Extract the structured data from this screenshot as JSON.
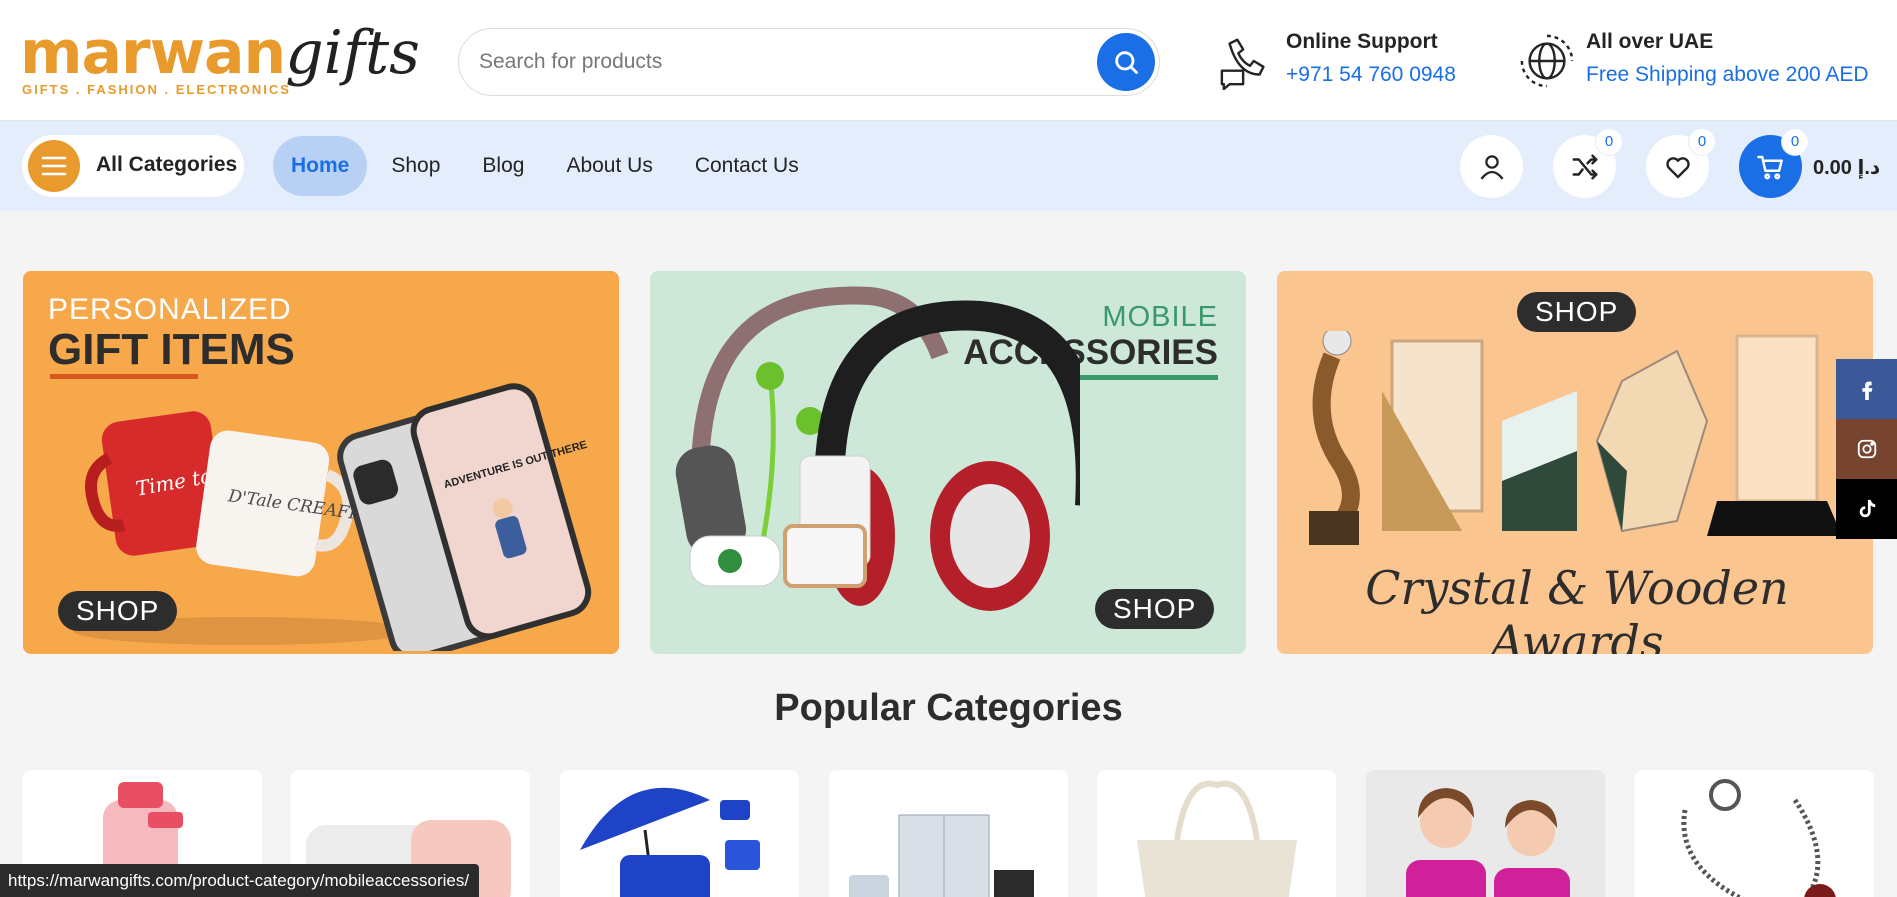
{
  "header": {
    "logo_main": "marwan",
    "logo_script": "gifts",
    "logo_tagline": "GIFTS . FASHION . ELECTRONICS",
    "search_placeholder": "Search for products",
    "support_title": "Online Support",
    "support_phone": "+971 54 760 0948",
    "shipping_title": "All over UAE",
    "shipping_text": "Free Shipping above 200 AED"
  },
  "nav": {
    "all_categories": "All Categories",
    "items": [
      "Home",
      "Shop",
      "Blog",
      "About Us",
      "Contact Us"
    ],
    "active": "Home",
    "compare_count": "0",
    "wishlist_count": "0",
    "cart_count": "0",
    "cart_total": "0.00 د.إ"
  },
  "banners": {
    "b1_small": "PERSONALIZED",
    "b1_big": "GIFT ITEMS",
    "b1_phone_text": "ADVENTURE IS OUT THERE",
    "b1_mug1": "Time to Coffee",
    "b1_mug2": "D'Tale CREAFRIX",
    "b1_shop": "SHOP",
    "b2_small": "MOBILE",
    "b2_big": "ACCESSORIES",
    "b2_shop": "SHOP",
    "b3_shop": "SHOP",
    "b3_script": "Crystal & Wooden Awards"
  },
  "popular": {
    "title": "Popular Categories"
  },
  "status_url": "https://marwangifts.com/product-category/mobileaccessories/",
  "colors": {
    "brand_orange": "#e99a2c",
    "brand_blue": "#1a6ee6",
    "nav_bg": "#e3edfb"
  },
  "icons": [
    "search-icon",
    "support-phone-icon",
    "globe-icon",
    "menu-icon",
    "user-icon",
    "shuffle-icon",
    "heart-icon",
    "cart-icon",
    "facebook-icon",
    "instagram-icon",
    "tiktok-icon"
  ]
}
